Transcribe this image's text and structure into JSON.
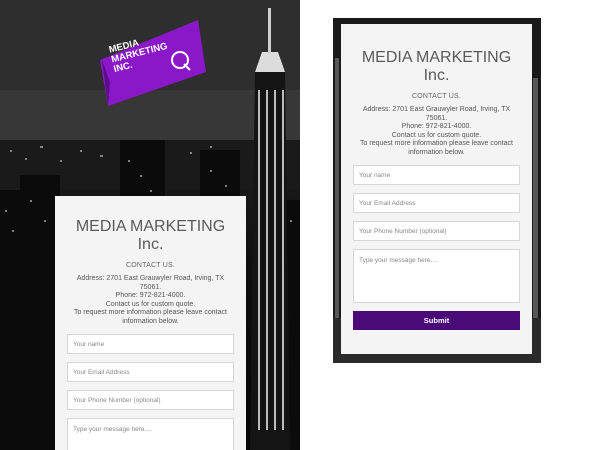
{
  "logo": {
    "text": "MEDIA\nMARKETING\nINC.",
    "color": "#8a18c8"
  },
  "card": {
    "title": "MEDIA MARKETING Inc.",
    "contact_head": "CONTACT US.",
    "address": "Address: 2701 East Grauwyler Road, Irving, TX 75061.",
    "phone": "Phone: 972-821-4000.",
    "quote": "Contact us for custom quote.",
    "request": "To request more information please leave contact information below."
  },
  "form": {
    "name_placeholder": "Your name",
    "email_placeholder": "Your Email Address",
    "phone_placeholder": "Your Phone Number (optional)",
    "message_placeholder": "Type your message here....",
    "submit_label": "Submit",
    "submit_color": "#4a0a78"
  }
}
